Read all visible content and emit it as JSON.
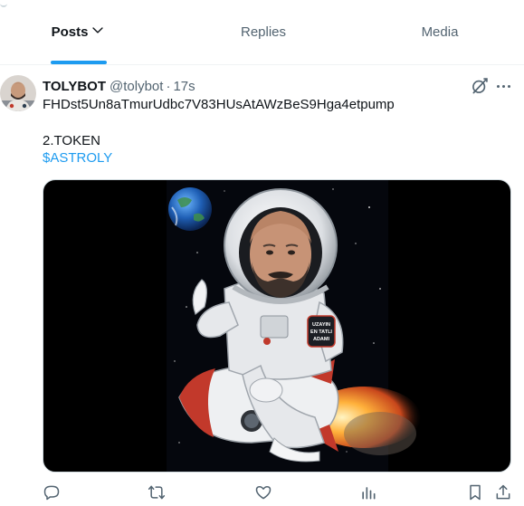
{
  "tabs": [
    {
      "label": "Posts",
      "active": true
    },
    {
      "label": "Replies",
      "active": false
    },
    {
      "label": "Media",
      "active": false
    }
  ],
  "post": {
    "author_name": "TOLYBOT",
    "author_handle": "@tolybot",
    "separator": "·",
    "time": "17s",
    "line1": "FHDst5Un8aTmurUdbc7V83HUsAtAWzBeS9Hga4etpump",
    "line2": "2.TOKEN",
    "cashtag": "$ASTROLY",
    "badge_text": [
      "UZAYIN",
      "EN TATLI",
      "ADAMI"
    ]
  },
  "icons": {
    "chevron": "chevron-down-icon",
    "grok": "grok-icon",
    "more": "more-icon",
    "reply": "reply-icon",
    "repost": "repost-icon",
    "like": "like-icon",
    "views": "views-icon",
    "bookmark": "bookmark-icon",
    "share": "share-icon"
  },
  "colors": {
    "accent": "#1d9bf0",
    "text_primary": "#0f1419",
    "text_secondary": "#536471",
    "divider": "#eff3f4"
  }
}
